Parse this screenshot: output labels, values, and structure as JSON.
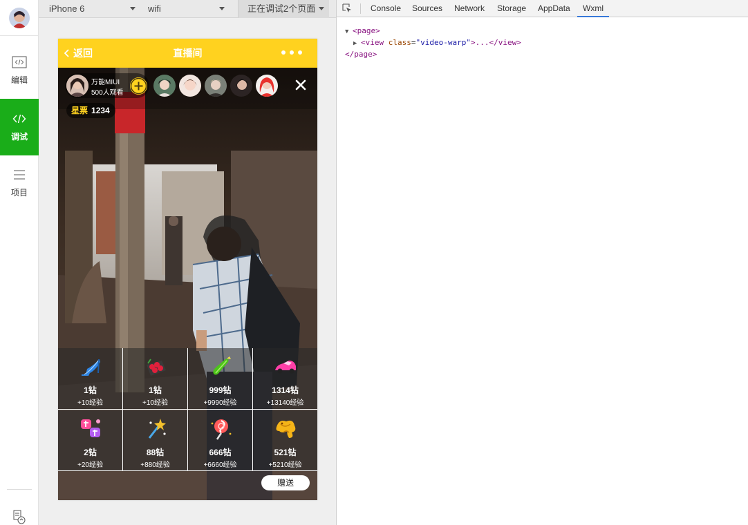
{
  "rail": {
    "items": [
      {
        "label": "编辑",
        "icon": "code-window-icon"
      },
      {
        "label": "调试",
        "icon": "code-brackets-icon"
      },
      {
        "label": "项目",
        "icon": "menu-lines-icon"
      }
    ]
  },
  "simulator": {
    "device": "iPhone 6",
    "network": "wifi",
    "pages": "正在调试2个页面"
  },
  "phone": {
    "nav": {
      "back": "返回",
      "title": "直播间"
    },
    "host": {
      "name": "万能MIUI",
      "watching": "500人观看"
    },
    "stars": {
      "label": "星票",
      "value": "1234"
    },
    "gifts": [
      {
        "icon": "high-heel-icon",
        "price": "1钻",
        "exp": "+10经验",
        "color": "#3a8ee6"
      },
      {
        "icon": "roses-icon",
        "price": "1钻",
        "exp": "+10经验",
        "color": "#e02040"
      },
      {
        "icon": "cucumber-icon",
        "price": "999钻",
        "exp": "+9990经验",
        "color": "#4cc41a"
      },
      {
        "icon": "sports-car-icon",
        "price": "1314钻",
        "exp": "+13140经验",
        "color": "#ff3fa8"
      },
      {
        "icon": "hug-icon",
        "price": "2钻",
        "exp": "+20经验",
        "color": "#ff4f9a"
      },
      {
        "icon": "magic-wand-icon",
        "price": "88钻",
        "exp": "+880经验",
        "color": "#f4c12c"
      },
      {
        "icon": "lollipop-icon",
        "price": "666钻",
        "exp": "+6660经验",
        "color": "#ff5a5a"
      },
      {
        "icon": "gold-dragon-icon",
        "price": "521钻",
        "exp": "+5210经验",
        "color": "#f5b418"
      }
    ],
    "send": "赠送"
  },
  "devtools": {
    "tabs": [
      "Console",
      "Sources",
      "Network",
      "Storage",
      "AppData",
      "Wxml"
    ],
    "active_tab": "Wxml",
    "tree": {
      "page_open": "<page>",
      "view_tag_open": "<view",
      "view_attr": "class",
      "view_attr_value": "\"video-warp\"",
      "view_rest": ">...</view>",
      "page_close": "</page>"
    }
  },
  "colors": {
    "accent_green": "#1aad19",
    "nav_yellow": "#ffd21f",
    "tab_blue": "#3879d9"
  }
}
